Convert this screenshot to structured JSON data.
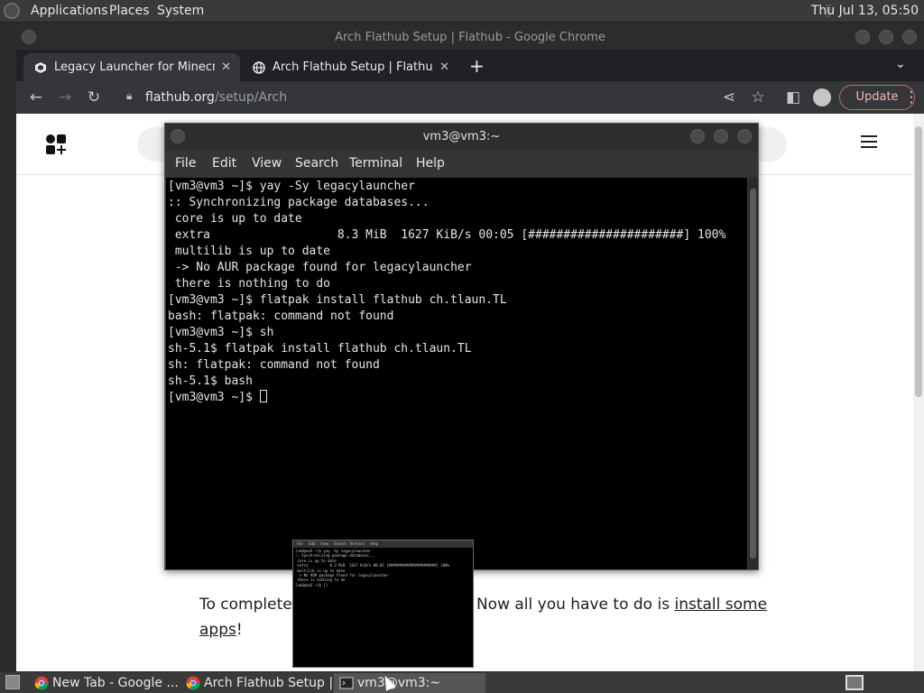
{
  "top_panel": {
    "menus": [
      "Applications",
      "Places",
      "System"
    ],
    "clock": "Thu Jul 13, 05:50"
  },
  "chrome": {
    "window_title": "Arch Flathub Setup | Flathub - Google Chrome",
    "tabs": [
      {
        "title": "Legacy Launcher for Minecraft",
        "active": true,
        "icon": "cube-icon"
      },
      {
        "title": "Arch Flathub Setup | Flathub",
        "active": false,
        "icon": "globe-icon"
      }
    ],
    "new_tab_symbol": "+",
    "url_host": "flathub.org",
    "url_path": "/setup/Arch",
    "update_label": "Update",
    "accent_update": "#f2b8b5"
  },
  "page": {
    "text_prefix": "To complete s",
    "text_mid": "Now all you have to do is ",
    "link_text": "install some apps",
    "text_suffix": "!"
  },
  "terminal": {
    "title": "vm3@vm3:~",
    "menu": [
      "File",
      "Edit",
      "View",
      "Search",
      "Terminal",
      "Help"
    ],
    "lines": [
      "[vm3@vm3 ~]$ yay -Sy legacylauncher",
      ":: Synchronizing package databases...",
      " core is up to date",
      " extra                  8.3 MiB  1627 KiB/s 00:05 [######################] 100%",
      " multilib is up to date",
      " -> No AUR package found for legacylauncher",
      " there is nothing to do",
      "[vm3@vm3 ~]$ flatpak install flathub ch.tlaun.TL",
      "bash: flatpak: command not found",
      "[vm3@vm3 ~]$ sh",
      "sh-5.1$ flatpak install flathub ch.tlaun.TL",
      "sh: flatpak: command not found",
      "sh-5.1$ bash"
    ],
    "prompt": "[vm3@vm3 ~]$ "
  },
  "preview": {
    "menu": [
      "File",
      "Edit",
      "View",
      "Search",
      "Terminal",
      "Help"
    ],
    "lines": [
      "[vm3@vm3 ~]$ yay -Sy legacylauncher",
      ":: Synchronizing package databases...",
      " core is up to date",
      " extra          8.3 MiB  1627 KiB/s 00:05 [######################] 100%",
      " multilib is up to date",
      " -> No AUR package found for legacylauncher",
      " there is nothing to do",
      "[vm3@vm3 ~]$ []"
    ]
  },
  "taskbar": {
    "tasks": [
      {
        "label": "New Tab - Google ...",
        "icon": "chrome-icon",
        "active": false
      },
      {
        "label": "Arch Flathub Setup |...",
        "icon": "chrome-icon",
        "active": false
      },
      {
        "label": "vm3@vm3:~",
        "icon": "terminal-icon",
        "active": true
      }
    ]
  }
}
